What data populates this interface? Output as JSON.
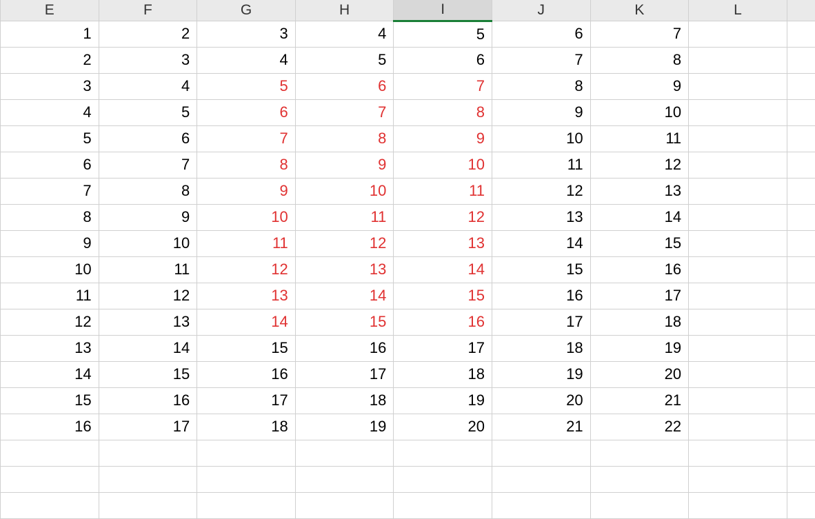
{
  "columns": [
    "E",
    "F",
    "G",
    "H",
    "I",
    "J",
    "K",
    "L",
    ""
  ],
  "selectedColumn": "I",
  "redCells": {
    "G": [
      2,
      3,
      4,
      5,
      6,
      7,
      8,
      9,
      10,
      11
    ],
    "H": [
      2,
      3,
      4,
      5,
      6,
      7,
      8,
      9,
      10,
      11
    ],
    "I": [
      2,
      3,
      4,
      5,
      6,
      7,
      8,
      9,
      10,
      11
    ]
  },
  "rows": [
    {
      "E": "1",
      "F": "2",
      "G": "3",
      "H": "4",
      "I": "5",
      "J": "6",
      "K": "7",
      "L": ""
    },
    {
      "E": "2",
      "F": "3",
      "G": "4",
      "H": "5",
      "I": "6",
      "J": "7",
      "K": "8",
      "L": ""
    },
    {
      "E": "3",
      "F": "4",
      "G": "5",
      "H": "6",
      "I": "7",
      "J": "8",
      "K": "9",
      "L": ""
    },
    {
      "E": "4",
      "F": "5",
      "G": "6",
      "H": "7",
      "I": "8",
      "J": "9",
      "K": "10",
      "L": ""
    },
    {
      "E": "5",
      "F": "6",
      "G": "7",
      "H": "8",
      "I": "9",
      "J": "10",
      "K": "11",
      "L": ""
    },
    {
      "E": "6",
      "F": "7",
      "G": "8",
      "H": "9",
      "I": "10",
      "J": "11",
      "K": "12",
      "L": ""
    },
    {
      "E": "7",
      "F": "8",
      "G": "9",
      "H": "10",
      "I": "11",
      "J": "12",
      "K": "13",
      "L": ""
    },
    {
      "E": "8",
      "F": "9",
      "G": "10",
      "H": "11",
      "I": "12",
      "J": "13",
      "K": "14",
      "L": ""
    },
    {
      "E": "9",
      "F": "10",
      "G": "11",
      "H": "12",
      "I": "13",
      "J": "14",
      "K": "15",
      "L": ""
    },
    {
      "E": "10",
      "F": "11",
      "G": "12",
      "H": "13",
      "I": "14",
      "J": "15",
      "K": "16",
      "L": ""
    },
    {
      "E": "11",
      "F": "12",
      "G": "13",
      "H": "14",
      "I": "15",
      "J": "16",
      "K": "17",
      "L": ""
    },
    {
      "E": "12",
      "F": "13",
      "G": "14",
      "H": "15",
      "I": "16",
      "J": "17",
      "K": "18",
      "L": ""
    },
    {
      "E": "13",
      "F": "14",
      "G": "15",
      "H": "16",
      "I": "17",
      "J": "18",
      "K": "19",
      "L": ""
    },
    {
      "E": "14",
      "F": "15",
      "G": "16",
      "H": "17",
      "I": "18",
      "J": "19",
      "K": "20",
      "L": ""
    },
    {
      "E": "15",
      "F": "16",
      "G": "17",
      "H": "18",
      "I": "19",
      "J": "20",
      "K": "21",
      "L": ""
    },
    {
      "E": "16",
      "F": "17",
      "G": "18",
      "H": "19",
      "I": "20",
      "J": "21",
      "K": "22",
      "L": ""
    },
    {
      "E": "",
      "F": "",
      "G": "",
      "H": "",
      "I": "",
      "J": "",
      "K": "",
      "L": ""
    },
    {
      "E": "",
      "F": "",
      "G": "",
      "H": "",
      "I": "",
      "J": "",
      "K": "",
      "L": ""
    },
    {
      "E": "",
      "F": "",
      "G": "",
      "H": "",
      "I": "",
      "J": "",
      "K": "",
      "L": ""
    }
  ]
}
